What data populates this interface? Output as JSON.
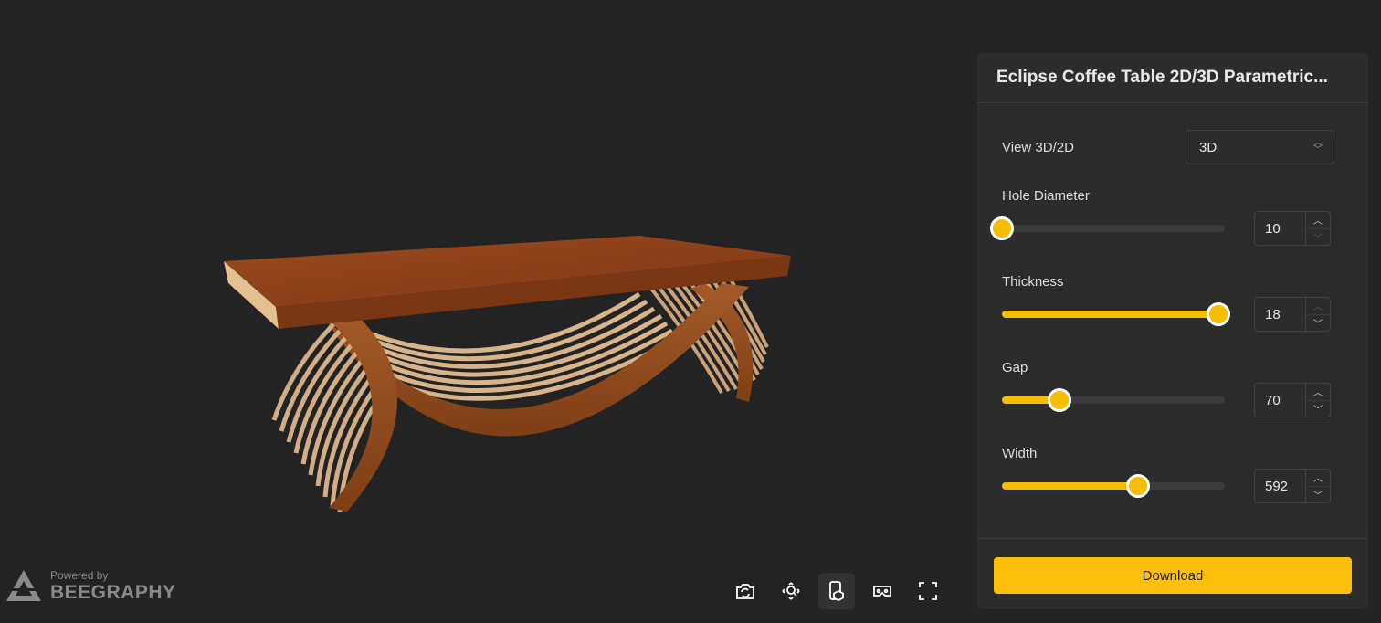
{
  "panel": {
    "title": "Eclipse Coffee Table 2D/3D Parametric...",
    "view": {
      "label": "View 3D/2D",
      "value": "3D"
    },
    "params": [
      {
        "label": "Hole Diameter",
        "value": "10",
        "fraction": 0.0
      },
      {
        "label": "Thickness",
        "value": "18",
        "fraction": 0.97
      },
      {
        "label": "Gap",
        "value": "70",
        "fraction": 0.26
      },
      {
        "label": "Width",
        "value": "592",
        "fraction": 0.61
      }
    ],
    "download_label": "Download"
  },
  "branding": {
    "powered_by": "Powered by",
    "name": "BEEGRAPHY"
  },
  "toolbar": {
    "icons": [
      "camera-rotate-icon",
      "zoom-extents-icon",
      "ar-view-icon",
      "vr-headset-icon",
      "fullscreen-icon"
    ],
    "active": "ar-view-icon"
  },
  "colors": {
    "accent": "#f7bd00",
    "background": "#232323",
    "panel": "#2c2c2c",
    "wood_top": "#8a3f18",
    "wood_slat": "#c99f6f"
  }
}
